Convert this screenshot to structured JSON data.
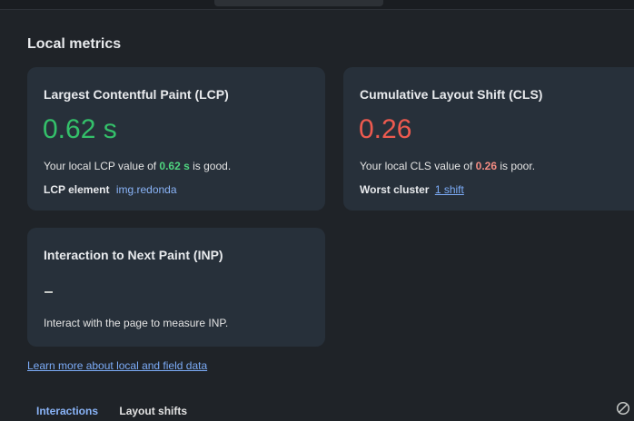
{
  "section": {
    "title": "Local metrics"
  },
  "lcp": {
    "title": "Largest Contentful Paint (LCP)",
    "value": "0.62 s",
    "desc_prefix": "Your local LCP value of ",
    "desc_value": "0.62 s",
    "desc_suffix": " is good.",
    "detail_label": "LCP element",
    "detail_value": "img.redonda",
    "rating_color": "#34c06a"
  },
  "cls": {
    "title": "Cumulative Layout Shift (CLS)",
    "value": "0.26",
    "desc_prefix": "Your local CLS value of ",
    "desc_value": "0.26",
    "desc_suffix": " is poor.",
    "detail_label": "Worst cluster",
    "detail_value": "1 shift",
    "rating_color": "#ee5a4f"
  },
  "inp": {
    "title": "Interaction to Next Paint (INP)",
    "value": "–",
    "desc": "Interact with the page to measure INP."
  },
  "learn_more": "Learn more about local and field data",
  "tabs": [
    {
      "label": "Interactions",
      "active": true
    },
    {
      "label": "Layout shifts",
      "active": false
    }
  ],
  "icons": {
    "clear": "clear-icon"
  },
  "colors": {
    "link": "#7cacf8",
    "card_bg": "#27303a",
    "page_bg": "#1f2328"
  }
}
